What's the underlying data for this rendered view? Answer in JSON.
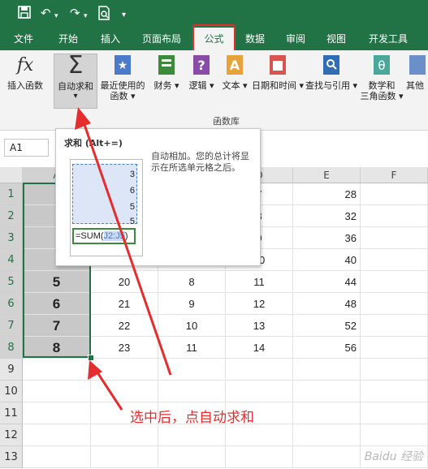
{
  "quick_access": {
    "save_icon": "save-icon",
    "undo_icon": "undo-icon",
    "redo_icon": "redo-icon",
    "preview_icon": "print-preview-icon",
    "more_icon": "customize-icon"
  },
  "tabs": [
    "文件",
    "开始",
    "插入",
    "页面布局",
    "公式",
    "数据",
    "审阅",
    "视图",
    "开发工具"
  ],
  "active_tab": "公式",
  "ribbon": {
    "buttons": [
      {
        "label": "插入函数",
        "icon": "fx-icon"
      },
      {
        "label": "自动求和",
        "icon": "sigma-icon",
        "dropdown": "▾"
      },
      {
        "label1": "最近使用的",
        "label2": "函数 ▾",
        "icon": "star-book-icon"
      },
      {
        "label": "财务 ▾",
        "icon": "finance-book-icon"
      },
      {
        "label": "逻辑 ▾",
        "icon": "logic-book-icon"
      },
      {
        "label": "文本 ▾",
        "icon": "text-book-icon"
      },
      {
        "label": "日期和时间 ▾",
        "icon": "calendar-book-icon"
      },
      {
        "label": "查找与引用 ▾",
        "icon": "lookup-book-icon"
      },
      {
        "label1": "数学和",
        "label2": "三角函数 ▾",
        "icon": "math-book-icon"
      },
      {
        "label": "其他",
        "icon": "more-book-icon"
      }
    ],
    "group_label": "函数库"
  },
  "namebox": "A1",
  "tooltip": {
    "title": "求和 (Alt+=)",
    "description": "自动相加。您的总计将显示在所选单元格之后。",
    "preview_values": [
      "3",
      "6",
      "5",
      "5"
    ],
    "preview_formula_prefix": "=SUM(",
    "preview_formula_ref": "J2:J5",
    "preview_formula_suffix": ")"
  },
  "columns": [
    "A",
    "B",
    "C",
    "D",
    "E",
    "F"
  ],
  "rows": [
    "1",
    "2",
    "3",
    "4",
    "5",
    "6",
    "7",
    "8",
    "9",
    "10",
    "11",
    "12",
    "13"
  ],
  "cells": {
    "D": [
      "7",
      "8",
      "9",
      "10",
      "11",
      "12",
      "13",
      "14"
    ],
    "E": [
      "28",
      "32",
      "36",
      "40",
      "44",
      "48",
      "52",
      "56"
    ],
    "A_visible": [
      "5",
      "6",
      "7",
      "8"
    ],
    "B_visible": [
      "20",
      "21",
      "22",
      "23"
    ],
    "C_visible": [
      "8",
      "9",
      "10",
      "11"
    ]
  },
  "annotation": "选中后，点自动求和",
  "watermark": "Baidu 经验"
}
